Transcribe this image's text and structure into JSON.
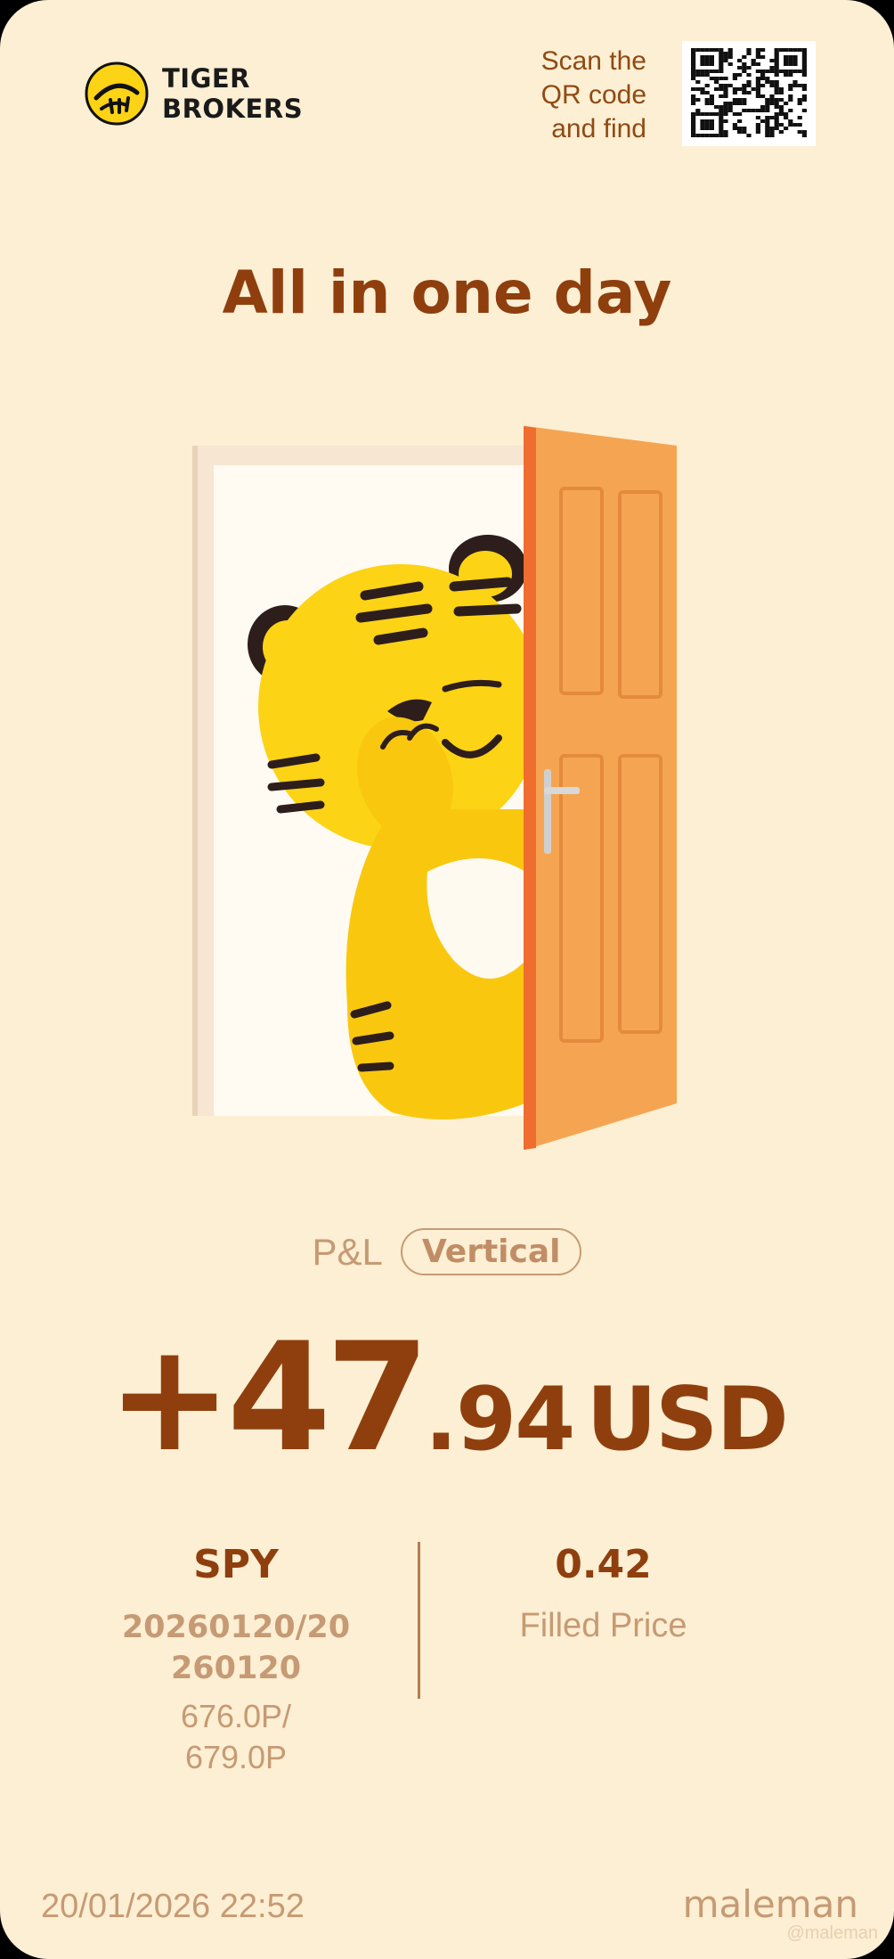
{
  "brand": {
    "logo_line1": "TIGER",
    "logo_line2": "BROKERS"
  },
  "scan_prompt": "Scan the\nQR code\nand find",
  "title": "All in one day",
  "pnl": {
    "label": "P&L",
    "badge": "Vertical",
    "integer": "+47",
    "decimal": ".94",
    "currency": "USD"
  },
  "position": {
    "symbol": "SPY",
    "expiry": "20260120/20\n260120",
    "strikes": "676.0P/\n679.0P",
    "filled_price": "0.42",
    "filled_price_label": "Filled Price"
  },
  "footer": {
    "datetime": "20/01/2026 22:52",
    "brand": "maleman",
    "watermark": "@maleman"
  },
  "colors": {
    "background": "#fcefd3",
    "title": "#8f3f0e",
    "muted": "#c69a74",
    "door": "#f5a552",
    "tiger": "#fcd315"
  },
  "icons": {
    "logo": "tiger-logo-icon",
    "qr": "qr-code-icon"
  }
}
